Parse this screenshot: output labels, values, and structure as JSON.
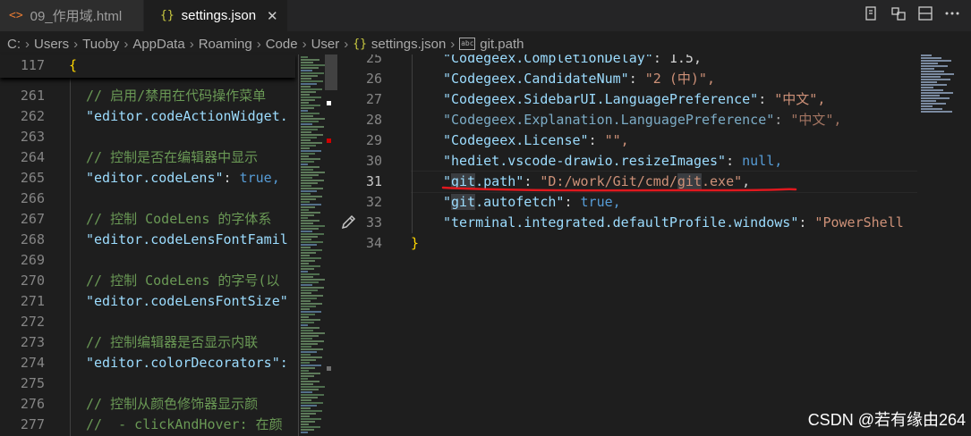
{
  "tabs": [
    {
      "icon": "<>",
      "label": "09_作用域.html",
      "active": false
    },
    {
      "icon": "{}",
      "label": "settings.json",
      "active": true,
      "close": "✕"
    }
  ],
  "editor_actions": [
    "compare-icon",
    "split-editor-icon",
    "toggle-panel-icon",
    "more-actions-icon"
  ],
  "breadcrumb": [
    "C:",
    "Users",
    "Tuoby",
    "AppData",
    "Roaming",
    "Code",
    "User",
    "settings.json",
    "git.path"
  ],
  "left_editor": {
    "sticky": {
      "num": "117",
      "text": "{"
    },
    "lines": [
      {
        "num": "261",
        "text": "// 启用/禁用在代码操作菜单"
      },
      {
        "num": "262",
        "key": "\"editor.codeActionWidget."
      },
      {
        "num": "263",
        "text": ""
      },
      {
        "num": "264",
        "text": "// 控制是否在编辑器中显示"
      },
      {
        "num": "265",
        "key": "\"editor.codeLens\"",
        "value": "true,"
      },
      {
        "num": "266",
        "text": ""
      },
      {
        "num": "267",
        "text": "// 控制 CodeLens 的字体系"
      },
      {
        "num": "268",
        "key": "\"editor.codeLensFontFamil"
      },
      {
        "num": "269",
        "text": ""
      },
      {
        "num": "270",
        "text": "// 控制 CodeLens 的字号(以"
      },
      {
        "num": "271",
        "key": "\"editor.codeLensFontSize\""
      },
      {
        "num": "272",
        "text": ""
      },
      {
        "num": "273",
        "text": "// 控制编辑器是否显示内联"
      },
      {
        "num": "274",
        "key": "\"editor.colorDecorators\":"
      },
      {
        "num": "275",
        "text": ""
      },
      {
        "num": "276",
        "text": "// 控制从颜色修饰器显示颜"
      },
      {
        "num": "277",
        "text": "//  - clickAndHover: 在颜"
      }
    ]
  },
  "right_editor": {
    "lines": [
      {
        "num": "25",
        "key": "\"Codegeex.CompletionDelay\"",
        "sep": ": ",
        "value": "1.5,"
      },
      {
        "num": "26",
        "key": "\"Codegeex.CandidateNum\"",
        "sep": ": ",
        "value": "\"2 (中)\","
      },
      {
        "num": "27",
        "key": "\"Codegeex.SidebarUI.LanguagePreference\"",
        "sep": ": ",
        "value": "\"中文\","
      },
      {
        "num": "28",
        "key": "\"Codegeex.Explanation.LanguagePreference\"",
        "sep": ": ",
        "value": "\"中文\","
      },
      {
        "num": "29",
        "key": "\"Codegeex.License\"",
        "sep": ": ",
        "value": "\"\","
      },
      {
        "num": "30",
        "key": "\"hediet.vscode-drawio.resizeImages\"",
        "sep": ": ",
        "value": "null,"
      },
      {
        "num": "31",
        "key_q": "\"",
        "key_hl": "git",
        "key_rest": ".path\"",
        "sep": ": ",
        "val_a": "\"D:/work/Git/cmd/",
        "val_hl": "git",
        "val_b": ".exe\"",
        "end": ","
      },
      {
        "num": "32",
        "key_q": "\"",
        "key_hl": "git",
        "key_rest": ".autofetch\"",
        "sep": ": ",
        "value": "true,"
      },
      {
        "num": "33",
        "key": "\"terminal.integrated.defaultProfile.windows\"",
        "sep": ": ",
        "value": "\"PowerShell"
      },
      {
        "num": "34",
        "text": "}"
      }
    ]
  },
  "watermark": "CSDN @若有缘由264"
}
